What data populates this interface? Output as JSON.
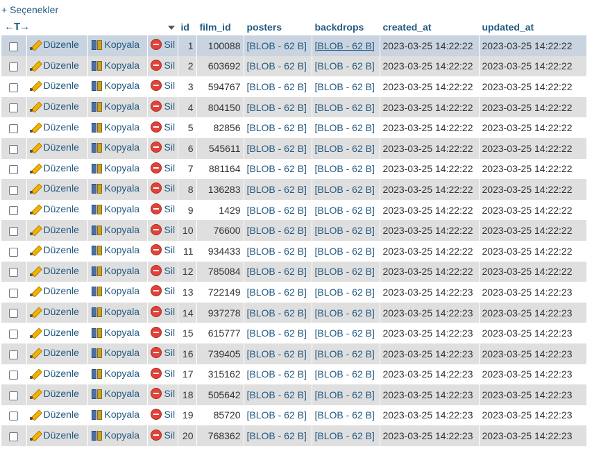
{
  "options_label": "+ Seçenekler",
  "header": {
    "arrows": "←T→",
    "columns": [
      "id",
      "film_id",
      "posters",
      "backdrops",
      "created_at",
      "updated_at"
    ]
  },
  "actions": {
    "edit": "Düzenle",
    "copy": "Kopyala",
    "delete": "Sil"
  },
  "icons": {
    "edit": "pencil-icon",
    "copy": "copy-icon",
    "delete": "delete-icon"
  },
  "rows": [
    {
      "id": "1",
      "film_id": "100088",
      "posters": "[BLOB - 62 B]",
      "backdrops": "[BLOB - 62 B]",
      "created_at": "2023-03-25 14:22:22",
      "updated_at": "2023-03-25 14:22:22"
    },
    {
      "id": "2",
      "film_id": "603692",
      "posters": "[BLOB - 62 B]",
      "backdrops": "[BLOB - 62 B]",
      "created_at": "2023-03-25 14:22:22",
      "updated_at": "2023-03-25 14:22:22"
    },
    {
      "id": "3",
      "film_id": "594767",
      "posters": "[BLOB - 62 B]",
      "backdrops": "[BLOB - 62 B]",
      "created_at": "2023-03-25 14:22:22",
      "updated_at": "2023-03-25 14:22:22"
    },
    {
      "id": "4",
      "film_id": "804150",
      "posters": "[BLOB - 62 B]",
      "backdrops": "[BLOB - 62 B]",
      "created_at": "2023-03-25 14:22:22",
      "updated_at": "2023-03-25 14:22:22"
    },
    {
      "id": "5",
      "film_id": "82856",
      "posters": "[BLOB - 62 B]",
      "backdrops": "[BLOB - 62 B]",
      "created_at": "2023-03-25 14:22:22",
      "updated_at": "2023-03-25 14:22:22"
    },
    {
      "id": "6",
      "film_id": "545611",
      "posters": "[BLOB - 62 B]",
      "backdrops": "[BLOB - 62 B]",
      "created_at": "2023-03-25 14:22:22",
      "updated_at": "2023-03-25 14:22:22"
    },
    {
      "id": "7",
      "film_id": "881164",
      "posters": "[BLOB - 62 B]",
      "backdrops": "[BLOB - 62 B]",
      "created_at": "2023-03-25 14:22:22",
      "updated_at": "2023-03-25 14:22:22"
    },
    {
      "id": "8",
      "film_id": "136283",
      "posters": "[BLOB - 62 B]",
      "backdrops": "[BLOB - 62 B]",
      "created_at": "2023-03-25 14:22:22",
      "updated_at": "2023-03-25 14:22:22"
    },
    {
      "id": "9",
      "film_id": "1429",
      "posters": "[BLOB - 62 B]",
      "backdrops": "[BLOB - 62 B]",
      "created_at": "2023-03-25 14:22:22",
      "updated_at": "2023-03-25 14:22:22"
    },
    {
      "id": "10",
      "film_id": "76600",
      "posters": "[BLOB - 62 B]",
      "backdrops": "[BLOB - 62 B]",
      "created_at": "2023-03-25 14:22:22",
      "updated_at": "2023-03-25 14:22:22"
    },
    {
      "id": "11",
      "film_id": "934433",
      "posters": "[BLOB - 62 B]",
      "backdrops": "[BLOB - 62 B]",
      "created_at": "2023-03-25 14:22:22",
      "updated_at": "2023-03-25 14:22:22"
    },
    {
      "id": "12",
      "film_id": "785084",
      "posters": "[BLOB - 62 B]",
      "backdrops": "[BLOB - 62 B]",
      "created_at": "2023-03-25 14:22:22",
      "updated_at": "2023-03-25 14:22:22"
    },
    {
      "id": "13",
      "film_id": "722149",
      "posters": "[BLOB - 62 B]",
      "backdrops": "[BLOB - 62 B]",
      "created_at": "2023-03-25 14:22:23",
      "updated_at": "2023-03-25 14:22:23"
    },
    {
      "id": "14",
      "film_id": "937278",
      "posters": "[BLOB - 62 B]",
      "backdrops": "[BLOB - 62 B]",
      "created_at": "2023-03-25 14:22:23",
      "updated_at": "2023-03-25 14:22:23"
    },
    {
      "id": "15",
      "film_id": "615777",
      "posters": "[BLOB - 62 B]",
      "backdrops": "[BLOB - 62 B]",
      "created_at": "2023-03-25 14:22:23",
      "updated_at": "2023-03-25 14:22:23"
    },
    {
      "id": "16",
      "film_id": "739405",
      "posters": "[BLOB - 62 B]",
      "backdrops": "[BLOB - 62 B]",
      "created_at": "2023-03-25 14:22:23",
      "updated_at": "2023-03-25 14:22:23"
    },
    {
      "id": "17",
      "film_id": "315162",
      "posters": "[BLOB - 62 B]",
      "backdrops": "[BLOB - 62 B]",
      "created_at": "2023-03-25 14:22:23",
      "updated_at": "2023-03-25 14:22:23"
    },
    {
      "id": "18",
      "film_id": "505642",
      "posters": "[BLOB - 62 B]",
      "backdrops": "[BLOB - 62 B]",
      "created_at": "2023-03-25 14:22:23",
      "updated_at": "2023-03-25 14:22:23"
    },
    {
      "id": "19",
      "film_id": "85720",
      "posters": "[BLOB - 62 B]",
      "backdrops": "[BLOB - 62 B]",
      "created_at": "2023-03-25 14:22:23",
      "updated_at": "2023-03-25 14:22:23"
    },
    {
      "id": "20",
      "film_id": "768362",
      "posters": "[BLOB - 62 B]",
      "backdrops": "[BLOB - 62 B]",
      "created_at": "2023-03-25 14:22:23",
      "updated_at": "2023-03-25 14:22:23"
    }
  ],
  "colors": {
    "link": "#235a81",
    "row_odd": "#ffffff",
    "row_even": "#dfdfdf",
    "row_hover": "#c9d4e0",
    "delete": "#e0433a"
  }
}
